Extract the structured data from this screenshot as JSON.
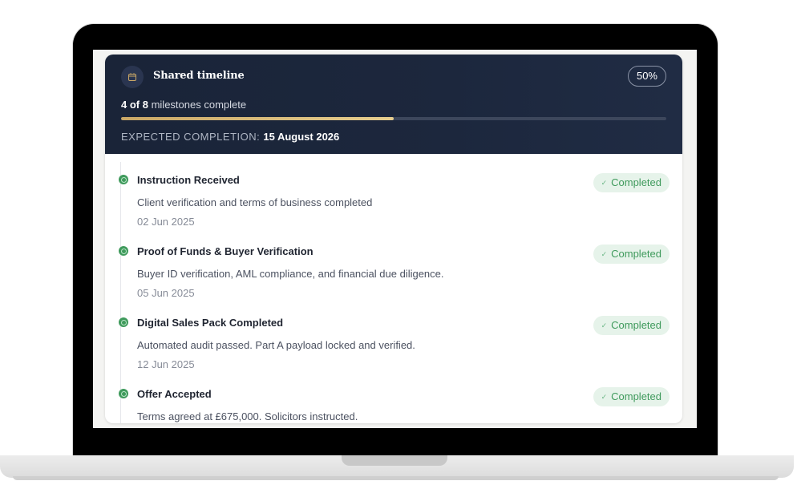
{
  "header": {
    "title": "Shared timeline",
    "percent": "50%",
    "completed_count": "4 of 8",
    "milestones_suffix": "milestones complete",
    "progress": 0.5,
    "expected_label": "EXPECTED COMPLETION:",
    "expected_date": "15 August 2026"
  },
  "milestones": [
    {
      "title": "Instruction Received",
      "description": "Client verification and terms of business completed",
      "date": "02 Jun 2025",
      "status": "Completed"
    },
    {
      "title": "Proof of Funds & Buyer Verification",
      "description": "Buyer ID verification, AML compliance, and financial due diligence.",
      "date": "05 Jun 2025",
      "status": "Completed"
    },
    {
      "title": "Digital Sales Pack Completed",
      "description": "Automated audit passed. Part A payload locked and verified.",
      "date": "12 Jun 2025",
      "status": "Completed"
    },
    {
      "title": "Offer Accepted",
      "description": "Terms agreed at £675,000. Solicitors instructed.",
      "date": "",
      "status": "Completed"
    }
  ],
  "colors": {
    "header_bg": "#1a2438",
    "accent_gold": "#d8ba7a",
    "success_green": "#3f9a5c",
    "success_bg": "#e6f3ea"
  },
  "icons": {
    "header_icon": "calendar-icon",
    "status_icon": "check-icon",
    "milestone_marker": "check-circle-icon"
  }
}
